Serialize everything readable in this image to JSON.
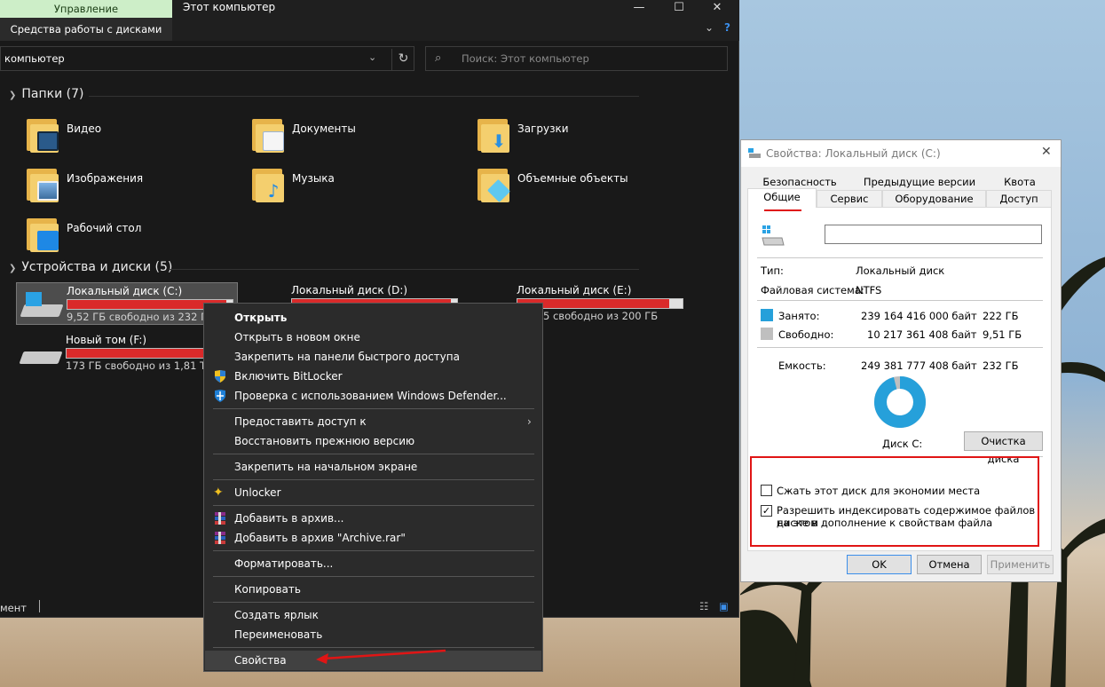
{
  "explorer": {
    "ribbon_tab": "Управление",
    "window_title": "Этот компьютер",
    "sub_tab": "Средства работы с дисками",
    "address": "компьютер",
    "search_placeholder": "Поиск: Этот компьютер",
    "groups": {
      "folders_title": "Папки (7)",
      "drives_title": "Устройства и диски (5)"
    },
    "folders": [
      {
        "label": "Видео",
        "icon": "video-folder-icon"
      },
      {
        "label": "Документы",
        "icon": "documents-folder-icon"
      },
      {
        "label": "Загрузки",
        "icon": "downloads-folder-icon"
      },
      {
        "label": "Изображения",
        "icon": "pictures-folder-icon"
      },
      {
        "label": "Музыка",
        "icon": "music-folder-icon"
      },
      {
        "label": "Объемные объекты",
        "icon": "3d-objects-folder-icon"
      },
      {
        "label": "Рабочий стол",
        "icon": "desktop-folder-icon"
      }
    ],
    "drives": [
      {
        "name": "Локальный диск (C:)",
        "free": "9,52 ГБ свободно из 232 ГБ",
        "used_fraction": 0.96
      },
      {
        "name": "Локальный диск (D:)",
        "free": "",
        "used_fraction": 0.96
      },
      {
        "name": "Локальный диск (E:)",
        "free": "5 свободно из 200 ГБ",
        "used_fraction": 0.92
      },
      {
        "name": "Новый том (F:)",
        "free": "173 ГБ свободно из 1,81 ТБ",
        "used_fraction": 0.9
      }
    ],
    "status": "мент"
  },
  "context_menu": {
    "items": [
      {
        "label": "Открыть",
        "bold": true
      },
      {
        "label": "Открыть в новом окне"
      },
      {
        "label": "Закрепить на панели быстрого доступа"
      },
      {
        "label": "Включить BitLocker",
        "icon": "shield-icon"
      },
      {
        "label": "Проверка с использованием Windows Defender...",
        "icon": "defender-icon"
      },
      {
        "label": "Предоставить доступ к",
        "submenu": true
      },
      {
        "label": "Восстановить прежнюю версию"
      },
      {
        "label": "Закрепить на начальном экране"
      },
      {
        "label": "Unlocker",
        "icon": "unlocker-wand-icon"
      },
      {
        "label": "Добавить в архив...",
        "icon": "winrar-icon"
      },
      {
        "label": "Добавить в архив \"Archive.rar\"",
        "icon": "winrar-icon"
      },
      {
        "label": "Форматировать..."
      },
      {
        "label": "Копировать"
      },
      {
        "label": "Создать ярлык"
      },
      {
        "label": "Переименовать"
      },
      {
        "label": "Свойства",
        "highlighted": true
      }
    ]
  },
  "properties": {
    "title": "Свойства: Локальный диск (C:)",
    "tabs_row1": [
      "Безопасность",
      "Предыдущие версии",
      "Квота"
    ],
    "tabs_row2": [
      "Общие",
      "Сервис",
      "Оборудование",
      "Доступ"
    ],
    "active_tab": "Общие",
    "name_value": "",
    "type_label": "Тип:",
    "type_value": "Локальный диск",
    "fs_label": "Файловая система:",
    "fs_value": "NTFS",
    "used_label": "Занято:",
    "used_bytes": "239 164 416 000 байт",
    "used_size": "222 ГБ",
    "free_label": "Свободно:",
    "free_bytes": "10 217 361 408 байт",
    "free_size": "9,51 ГБ",
    "capacity_label": "Емкость:",
    "capacity_bytes": "249 381 777 408 байт",
    "capacity_size": "232 ГБ",
    "disk_label": "Диск C:",
    "cleanup_button": "Очистка диска",
    "compress_label": "Сжать этот диск для экономии места",
    "compress_checked": false,
    "index_label_1": "Разрешить индексировать содержимое файлов на этом",
    "index_label_2": "диске в дополнение к свойствам файла",
    "index_checked": true,
    "ok": "OK",
    "cancel": "Отмена",
    "apply": "Применить",
    "used_fraction": 0.959,
    "colors": {
      "used": "#26a0da",
      "free": "#bfbfbf"
    }
  }
}
